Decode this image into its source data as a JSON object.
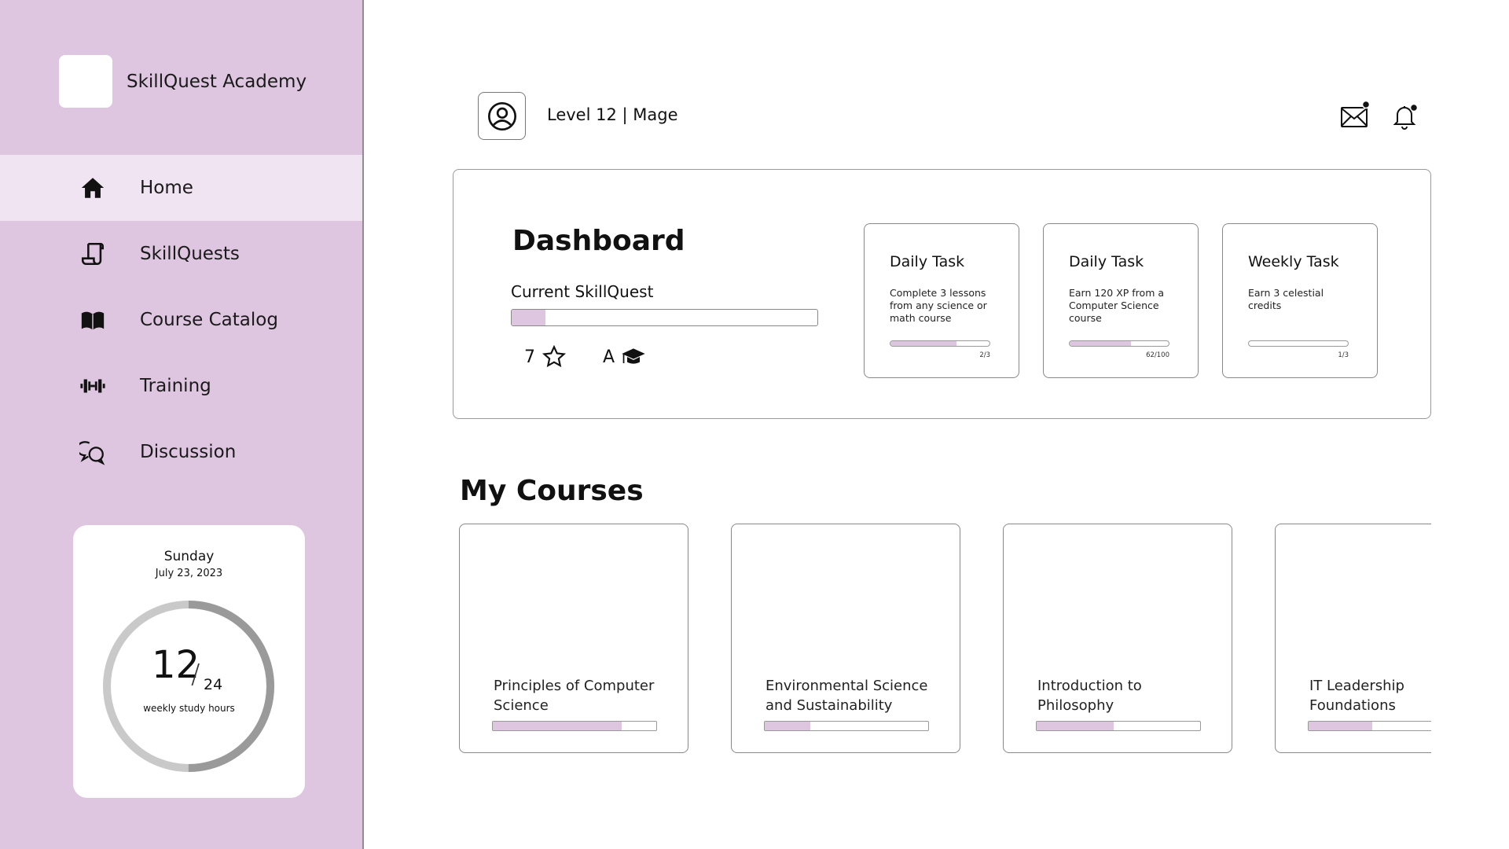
{
  "app": {
    "name": "SkillQuest Academy"
  },
  "sidebar": {
    "items": [
      {
        "label": "Home",
        "icon": "home-icon",
        "active": true
      },
      {
        "label": "SkillQuests",
        "icon": "scroll-icon",
        "active": false
      },
      {
        "label": "Course Catalog",
        "icon": "book-icon",
        "active": false
      },
      {
        "label": "Training",
        "icon": "dumbbell-icon",
        "active": false
      },
      {
        "label": "Discussion",
        "icon": "chat-icon",
        "active": false
      }
    ],
    "study": {
      "day": "Sunday",
      "date": "July 23, 2023",
      "hours": "12",
      "total": "24",
      "label": "weekly study hours",
      "progress": 0.5
    }
  },
  "header": {
    "level": "Level 12 | Mage"
  },
  "dashboard": {
    "title": "Dashboard",
    "current_label": "Current SkillQuest",
    "current_progress": 0.11,
    "stars": "7",
    "grade": "A",
    "tasks": [
      {
        "title": "Daily Task",
        "desc": "Complete 3 lessons from any science or math course",
        "count": "2/3",
        "progress": 0.67
      },
      {
        "title": "Daily Task",
        "desc": "Earn 120 XP from a Computer Science course",
        "count": "62/100",
        "progress": 0.62
      },
      {
        "title": "Weekly Task",
        "desc": "Earn 3 celestial credits",
        "count": "1/3",
        "progress": 0.0
      }
    ]
  },
  "courses": {
    "title": "My Courses",
    "items": [
      {
        "name": "Principles of Computer Science",
        "progress": 0.79
      },
      {
        "name": "Environmental Science and Sustainability",
        "progress": 0.28
      },
      {
        "name": "Introduction to Philosophy",
        "progress": 0.47
      },
      {
        "name": "IT Leadership Foundations",
        "progress": 0.39
      }
    ]
  },
  "colors": {
    "accent": "#dec6e0",
    "accent_light": "#f1e4f2",
    "ring_track": "#c9c9c9",
    "ring_fill": "#9a9a9a"
  }
}
